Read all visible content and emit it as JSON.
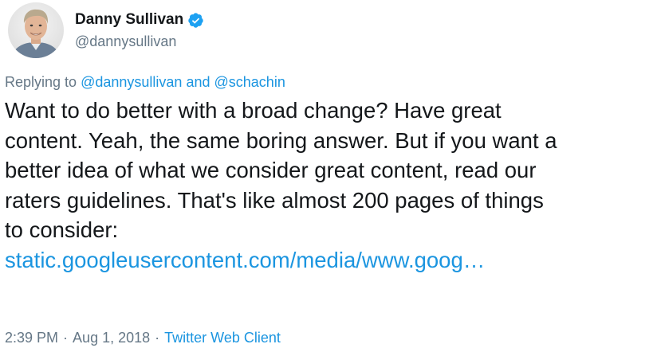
{
  "user": {
    "display_name": "Danny Sullivan",
    "handle": "@dannysullivan",
    "verified_icon": "verified-badge-icon"
  },
  "reply": {
    "prefix": "Replying to",
    "handle_1": "@dannysullivan",
    "conjunction": "and",
    "handle_2": "@schachin"
  },
  "tweet": {
    "lines": [
      "Want to do better with a broad change? Have great",
      "content. Yeah, the same boring answer. But if you want a",
      "better idea of what we consider great content, read our",
      "raters guidelines. That's like almost 200 pages of things",
      "to consider:"
    ],
    "url": "static.googleusercontent.com/media/www.goog…"
  },
  "meta": {
    "time": "2:39 PM",
    "separator": "·",
    "date": "Aug 1, 2018",
    "client": "Twitter Web Client"
  },
  "colors": {
    "link": "#1b95e0",
    "secondary_text": "#657786",
    "primary_text": "#14171a",
    "verified": "#1da1f2"
  }
}
